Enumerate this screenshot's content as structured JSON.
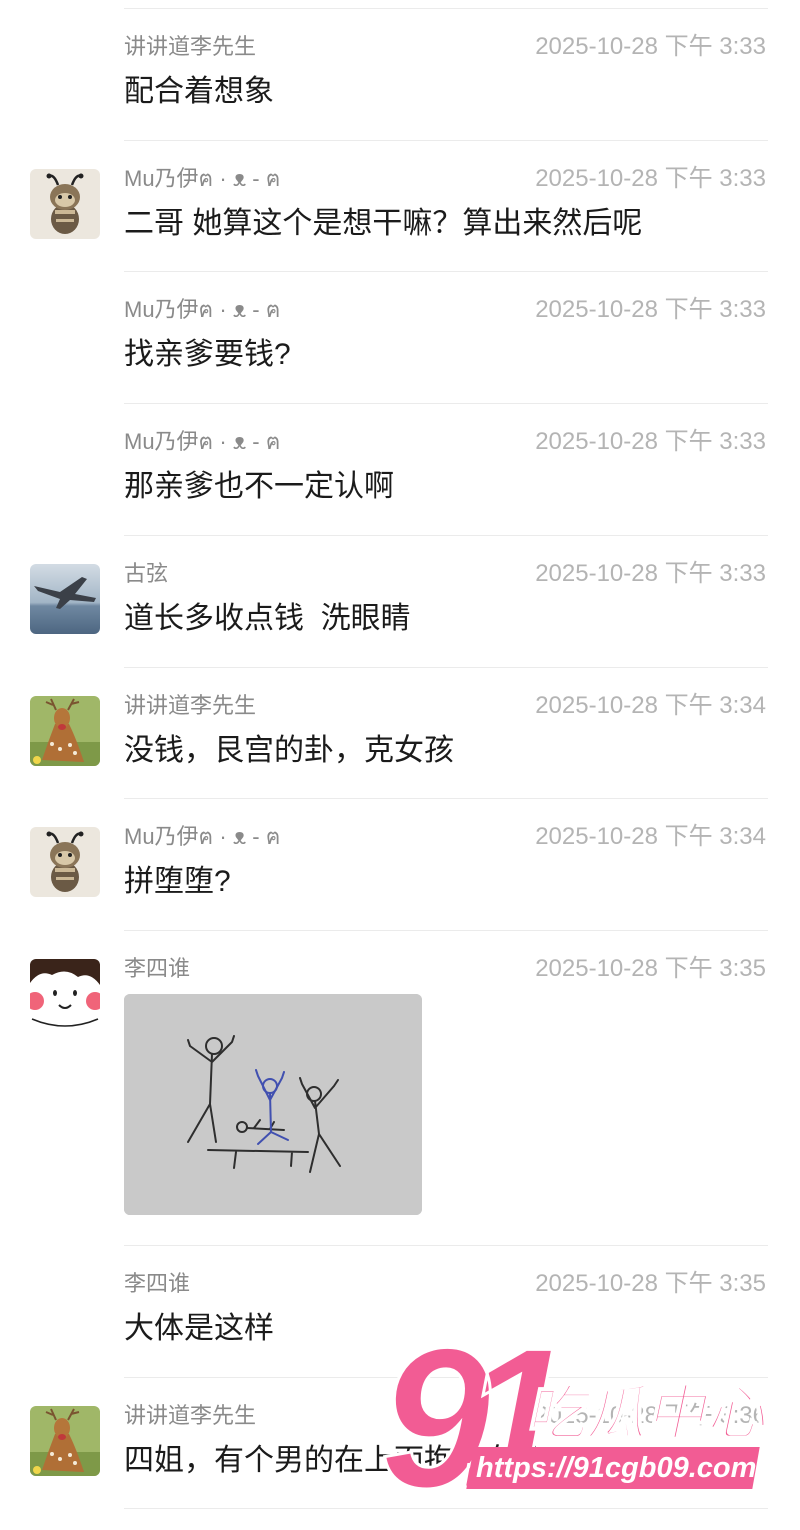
{
  "chat": {
    "messages": [
      {
        "sender": "讲讲道李先生",
        "time": "2025-10-28 下午 3:33",
        "text": "配合着想象"
      },
      {
        "sender": "Mu乃伊ฅ · ᴥ - ฅ",
        "time": "2025-10-28 下午 3:33",
        "text": "二哥 她算这个是想干嘛？算出来然后呢",
        "avatar_icon": "mummy-cat-avatar-icon"
      },
      {
        "sender": "Mu乃伊ฅ · ᴥ - ฅ",
        "time": "2025-10-28 下午 3:33",
        "text": "找亲爹要钱?"
      },
      {
        "sender": "Mu乃伊ฅ · ᴥ - ฅ",
        "time": "2025-10-28 下午 3:33",
        "text": "那亲爹也不一定认啊"
      },
      {
        "sender": "古弦",
        "time": "2025-10-28 下午 3:33",
        "text": "道长多收点钱  洗眼睛",
        "avatar_icon": "fighter-jet-avatar-icon"
      },
      {
        "sender": "讲讲道李先生",
        "time": "2025-10-28 下午 3:34",
        "text": "没钱，艮宫的卦，克女孩",
        "avatar_icon": "deer-avatar-icon"
      },
      {
        "sender": "Mu乃伊ฅ · ᴥ - ฅ",
        "time": "2025-10-28 下午 3:34",
        "text": "拼堕堕?",
        "avatar_icon": "mummy-cat-avatar-icon"
      },
      {
        "sender": "李四谁",
        "time": "2025-10-28 下午 3:35",
        "image_icon": "stick-figure-drawing-image",
        "avatar_icon": "cartoon-face-avatar-icon"
      },
      {
        "sender": "李四谁",
        "time": "2025-10-28 下午 3:35",
        "text": "大体是这样"
      },
      {
        "sender": "讲讲道李先生",
        "time": "2025-10-28 下午 3:36",
        "text": "四姐，有个男的在上面抱着女孩",
        "avatar_icon": "deer-avatar-icon"
      }
    ]
  },
  "watermark": {
    "logo_number": "91",
    "logo_text": "吃瓜中心",
    "url": "https://91cgb09.com"
  },
  "colors": {
    "sender": "#8a8a8a",
    "time": "#b4b4b4",
    "message": "#1b1b1b",
    "divider": "#ebebeb",
    "watermark_pink": "#f25c94"
  }
}
